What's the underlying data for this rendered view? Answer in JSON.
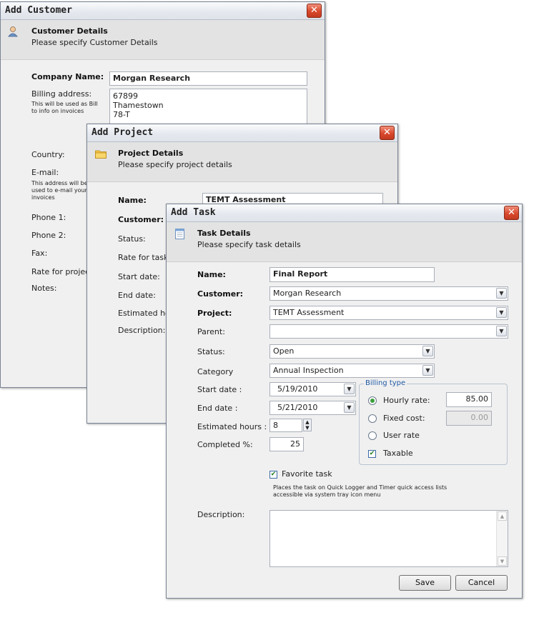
{
  "customer": {
    "title": "Add Customer",
    "header_title": "Customer Details",
    "header_sub": "Please specify Customer Details",
    "labels": {
      "company": "Company Name:",
      "billing": "Billing address:",
      "billing_hint": "This will be used as Bill to info on invoices",
      "country": "Country:",
      "email": "E-mail:",
      "email_hint": "This address will be used to e-mail your invoices",
      "phone1": "Phone 1:",
      "phone2": "Phone 2:",
      "fax": "Fax:",
      "rate": "Rate for project:",
      "notes": "Notes:"
    },
    "company_value": "Morgan Research",
    "billing_lines": [
      "67899",
      "Thamestown",
      "78-T"
    ]
  },
  "project": {
    "title": "Add Project",
    "header_title": "Project Details",
    "header_sub": "Please specify project details",
    "labels": {
      "name": "Name:",
      "customer": "Customer:",
      "status": "Status:",
      "rate": "Rate for tasks",
      "start": "Start date:",
      "end": "End date:",
      "est": "Estimated hou",
      "desc": "Description:"
    },
    "name_value": "TEMT Assessment"
  },
  "task": {
    "title": "Add Task",
    "header_title": "Task Details",
    "header_sub": "Please specify task details",
    "labels": {
      "name": "Name:",
      "customer": "Customer:",
      "project": "Project:",
      "parent": "Parent:",
      "status": "Status:",
      "category": "Category",
      "start": "Start date :",
      "end": "End date :",
      "est": "Estimated hours :",
      "completed": "Completed %:",
      "description": "Description:"
    },
    "values": {
      "name": "Final Report",
      "customer": "Morgan Research",
      "project": "TEMT Assessment",
      "parent": "",
      "status": "Open",
      "category": "Annual Inspection",
      "start": "5/19/2010",
      "end": "5/21/2010",
      "est": "8",
      "completed": "25"
    },
    "billing": {
      "legend": "Billing type",
      "hourly_label": "Hourly rate:",
      "hourly_value": "85.00",
      "fixed_label": "Fixed cost:",
      "fixed_value": "0.00",
      "user_rate_label": "User rate",
      "taxable_label": "Taxable",
      "selected": "hourly",
      "taxable": true
    },
    "favorite_label": "Favorite task",
    "favorite_checked": true,
    "favorite_hint_1": "Places the task on Quick Logger and Timer quick access lists",
    "favorite_hint_2": "accessible via system tray icon menu",
    "save_label": "Save",
    "cancel_label": "Cancel"
  },
  "icons": {
    "close": "close-icon",
    "customer": "user-icon",
    "project": "folder-icon",
    "task": "document-icon"
  },
  "colors": {
    "close_button": "#d9482c",
    "header_band": "#e3e3e3",
    "legend_text": "#1f5aa6",
    "dialog_bg": "#f0f0f0"
  }
}
